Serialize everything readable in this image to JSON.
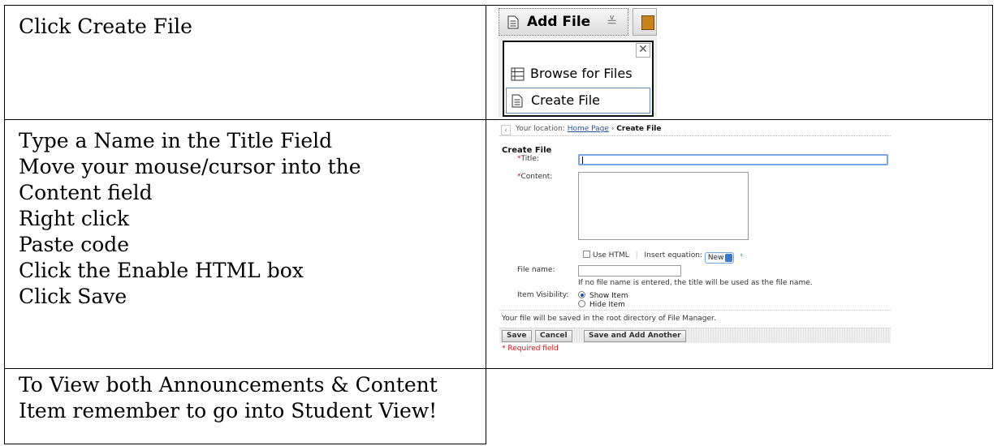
{
  "rows": [
    {
      "instruction": "Click Create File"
    },
    {
      "instruction": "Type a Name in the Title Field\nMove your mouse/cursor into the\nContent field\nRight click\nPaste code\nClick the Enable HTML box\nClick Save"
    },
    {
      "instruction": "To View both Announcements & Content\nItem remember to go into Student View!"
    }
  ],
  "add_file_menu": {
    "button_label": "Add File",
    "close_glyph": "✕",
    "items": [
      "Browse for Files",
      "Create File"
    ]
  },
  "create_file_form": {
    "breadcrumb_prefix": "Your location:",
    "breadcrumb_link": "Home Page",
    "breadcrumb_sep": "›",
    "breadcrumb_current": "Create File",
    "heading": "Create File",
    "title_label": "Title:",
    "content_label": "Content:",
    "use_html_label": "Use HTML",
    "insert_equation_label": "Insert equation:",
    "equation_selected": "New",
    "file_name_label": "File name:",
    "file_name_hint": "If no file name is entered, the title will be used as the file name.",
    "visibility_label": "Item Visibility:",
    "visibility_options": [
      "Show Item",
      "Hide Item"
    ],
    "visibility_selected": "Show Item",
    "saved_note": "Your file will be saved in the root directory of File Manager.",
    "buttons": {
      "save": "Save",
      "cancel": "Cancel",
      "save_and_add": "Save and Add Another"
    },
    "required_note": "* Required field"
  }
}
